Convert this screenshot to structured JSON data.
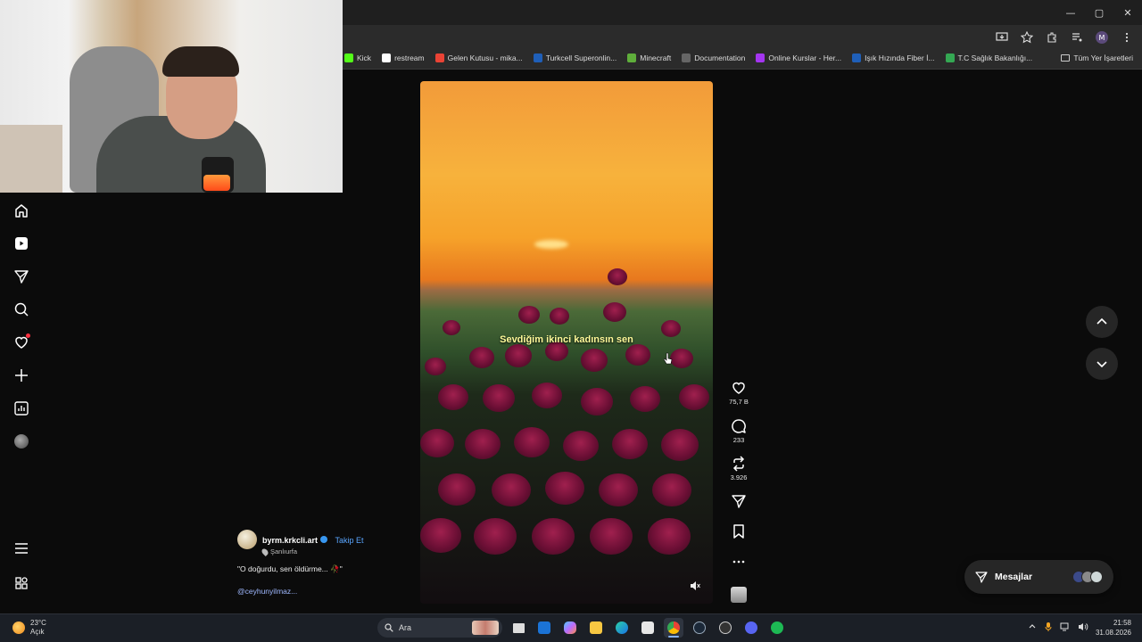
{
  "window": {
    "minimize_glyph": "—",
    "maximize_glyph": "▢",
    "close_glyph": "✕"
  },
  "bookmarks": [
    {
      "label": "Kick",
      "color": "#53fc18"
    },
    {
      "label": "restream",
      "color": "#ffffff"
    },
    {
      "label": "Gelen Kutusu - mika...",
      "color": "#ea4335"
    },
    {
      "label": "Turkcell Superonlin...",
      "color": "#1f5fb8"
    },
    {
      "label": "Minecraft",
      "color": "#5fae3b"
    },
    {
      "label": "Documentation",
      "color": "#666666"
    },
    {
      "label": "Online Kurslar - Her...",
      "color": "#a435f0"
    },
    {
      "label": "Işık Hızında Fiber İ...",
      "color": "#1f5fb8"
    },
    {
      "label": "T.C Sağlık Bakanlığı...",
      "color": "#34a853"
    }
  ],
  "bookmarks_all": "Tüm Yer İşaretleri",
  "profile_initial": "M",
  "video": {
    "caption": "Sevdiğim ikinci kadınsın sen"
  },
  "actions": {
    "likes": "75,7 B",
    "comments": "233",
    "reposts": "3.926"
  },
  "post": {
    "username": "byrm.krkcli.art",
    "follow": "Takip Et",
    "location": "Şanlıurfa",
    "caption": "\"O doğurdu, sen öldürme... 🥀\"",
    "mention": "@ceyhunyilmaz..."
  },
  "messages": {
    "label": "Mesajlar"
  },
  "taskbar": {
    "temperature": "23°C",
    "weather": "Açık",
    "search_placeholder": "Ara",
    "time": "21:58",
    "date": "31.08.2026"
  },
  "colors": {
    "accent_blue": "#3897f0",
    "like_red": "#ff3040",
    "caption_yellow": "#fffb9a"
  },
  "icons": {
    "nav": [
      "home-icon",
      "reels-icon",
      "messenger-icon",
      "search-icon",
      "heart-icon",
      "plus-icon",
      "insights-icon",
      "profile-avatar"
    ],
    "actions": [
      "heart-icon",
      "comment-icon",
      "repost-icon",
      "share-icon",
      "bookmark-icon",
      "more-icon"
    ]
  }
}
